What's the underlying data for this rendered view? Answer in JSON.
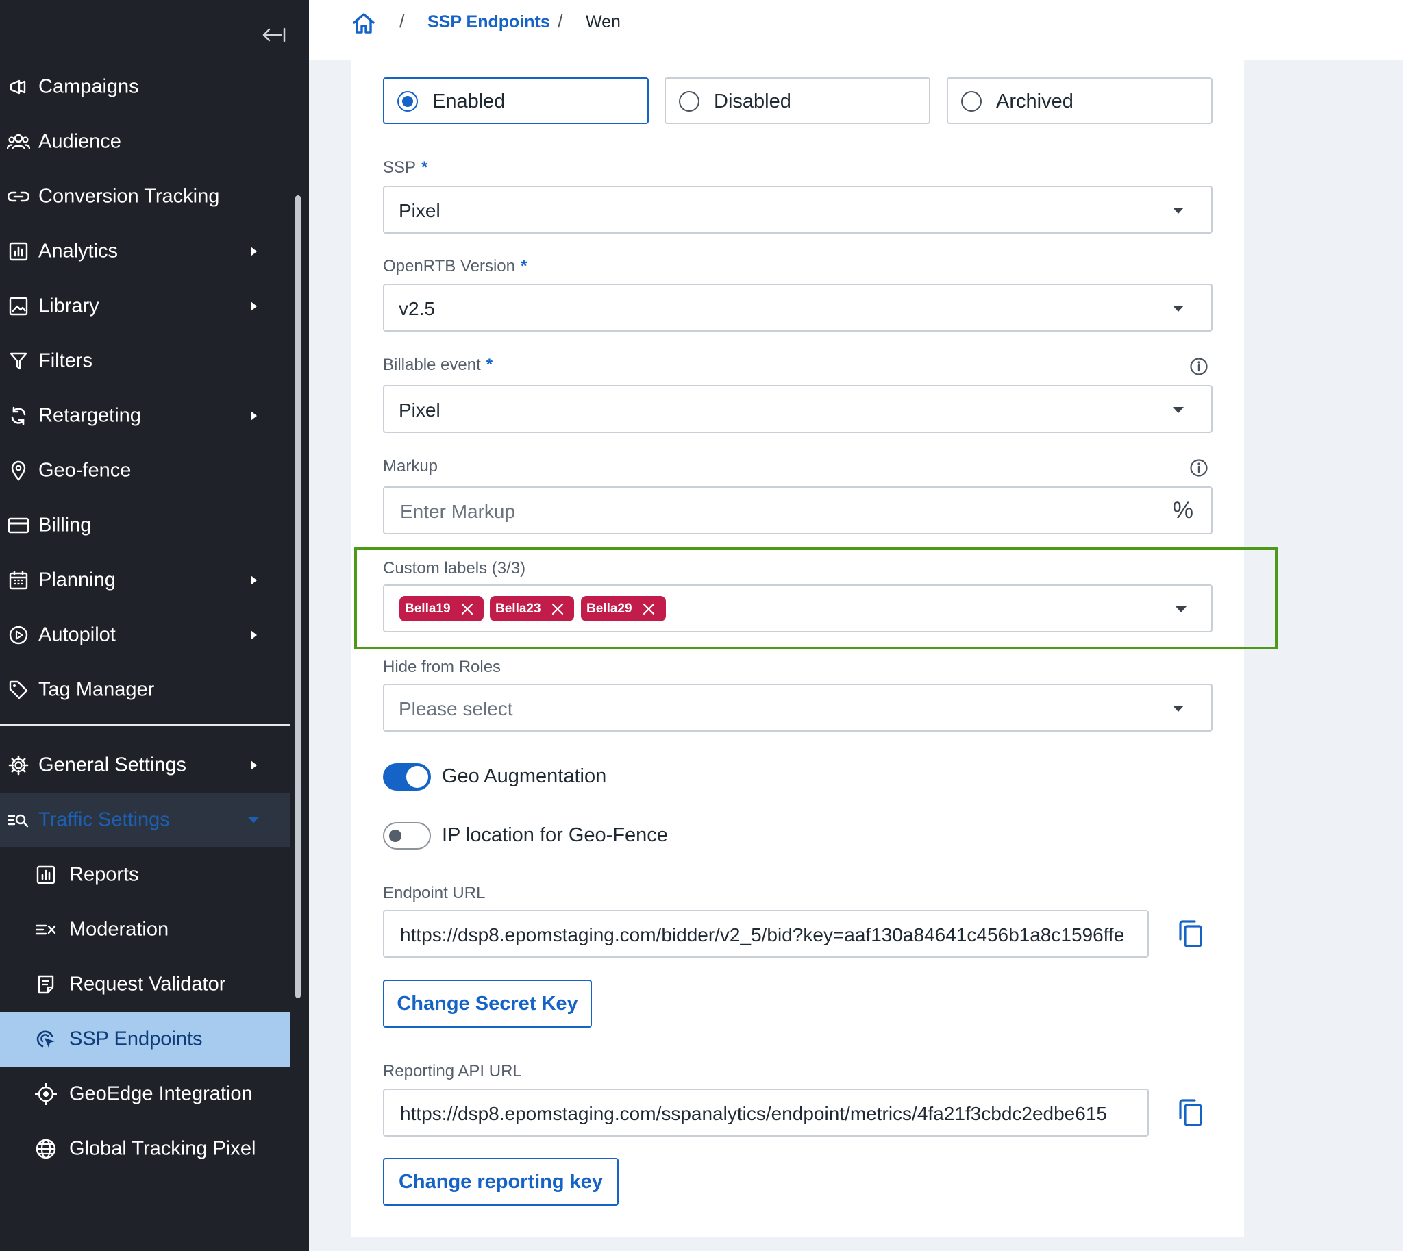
{
  "sidebar": {
    "items": [
      {
        "id": "campaigns",
        "label": "Campaigns",
        "icon": "megaphone-icon"
      },
      {
        "id": "audience",
        "label": "Audience",
        "icon": "users-icon"
      },
      {
        "id": "conversion-tracking",
        "label": "Conversion Tracking",
        "icon": "link-icon"
      },
      {
        "id": "analytics",
        "label": "Analytics",
        "icon": "bar-chart-icon"
      },
      {
        "id": "library",
        "label": "Library",
        "icon": "image-icon"
      },
      {
        "id": "filters",
        "label": "Filters",
        "icon": "filter-icon"
      },
      {
        "id": "retargeting",
        "label": "Retargeting",
        "icon": "refresh-icon"
      },
      {
        "id": "geo-fence",
        "label": "Geo-fence",
        "icon": "map-pin-icon"
      },
      {
        "id": "billing",
        "label": "Billing",
        "icon": "credit-card-icon"
      },
      {
        "id": "planning",
        "label": "Planning",
        "icon": "calendar-icon"
      },
      {
        "id": "autopilot",
        "label": "Autopilot",
        "icon": "play-circle-icon"
      },
      {
        "id": "tag-manager",
        "label": "Tag Manager",
        "icon": "tag-icon"
      }
    ],
    "settings": [
      {
        "id": "general-settings",
        "label": "General Settings",
        "icon": "gear-icon"
      },
      {
        "id": "traffic-settings",
        "label": "Traffic Settings",
        "icon": "list-search-icon"
      }
    ],
    "sub_items": [
      {
        "id": "reports",
        "label": "Reports",
        "icon": "report-icon"
      },
      {
        "id": "moderation",
        "label": "Moderation",
        "icon": "moderation-icon"
      },
      {
        "id": "request-validator",
        "label": "Request Validator",
        "icon": "document-icon"
      },
      {
        "id": "ssp-endpoints",
        "label": "SSP Endpoints",
        "icon": "target-cursor-icon"
      },
      {
        "id": "geoedge-integration",
        "label": "GeoEdge Integration",
        "icon": "crosshair-icon"
      },
      {
        "id": "global-tracking-pixel",
        "label": "Global Tracking Pixel",
        "icon": "globe-icon"
      }
    ]
  },
  "breadcrumb": {
    "sep": "/",
    "link": "SSP Endpoints",
    "current": "Wen"
  },
  "status": {
    "options": [
      "Enabled",
      "Disabled",
      "Archived"
    ],
    "selected": "Enabled"
  },
  "form": {
    "required_mark": "*",
    "ssp": {
      "label": "SSP",
      "value": "Pixel"
    },
    "openrtb": {
      "label": "OpenRTB Version",
      "value": "v2.5"
    },
    "billable": {
      "label": "Billable event",
      "value": "Pixel"
    },
    "markup": {
      "label": "Markup",
      "placeholder": "Enter Markup",
      "suffix": "%"
    },
    "custom_labels": {
      "label": "Custom labels (3/3)",
      "chips": [
        "Bella19",
        "Bella23",
        "Bella29"
      ]
    },
    "hide_roles": {
      "label": "Hide from Roles",
      "placeholder": "Please select"
    },
    "geo_augmentation": {
      "label": "Geo Augmentation",
      "on": true
    },
    "ip_location": {
      "label": "IP location for Geo-Fence",
      "on": false
    },
    "endpoint_url": {
      "label": "Endpoint URL",
      "value": "https://dsp8.epomstaging.com/bidder/v2_5/bid?key=aaf130a84641c456b1a8c1596ffe"
    },
    "change_secret_key": "Change Secret Key",
    "reporting_url": {
      "label": "Reporting API URL",
      "value": "https://dsp8.epomstaging.com/sspanalytics/endpoint/metrics/4fa21f3cbdc2edbe615"
    },
    "change_reporting_key": "Change reporting key"
  },
  "colors": {
    "accent": "#1663c7",
    "sidebar_bg": "#1f2329",
    "chip": "#c21d4a",
    "highlight": "#4d9a1a",
    "active_item": "#a7cbef"
  }
}
